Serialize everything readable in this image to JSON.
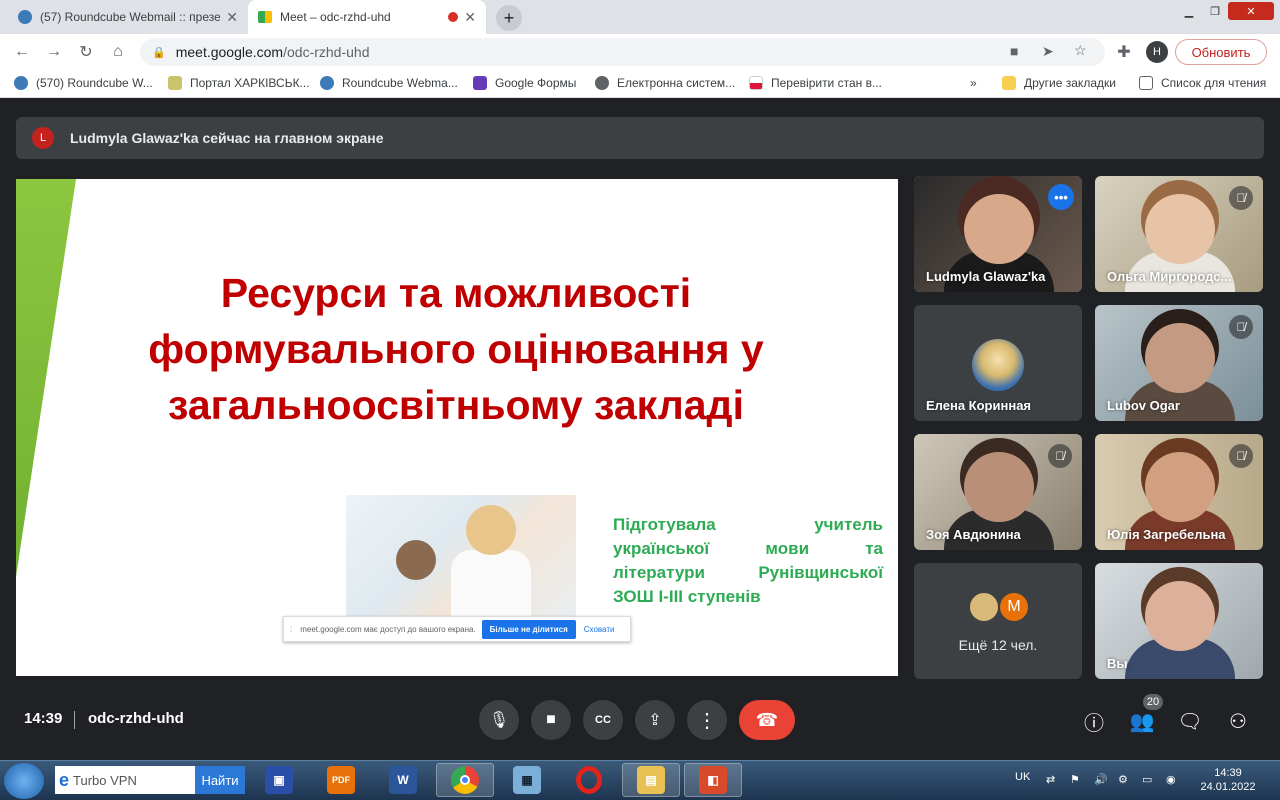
{
  "browser": {
    "tabs": [
      {
        "title": "(57) Roundcube Webmail :: презе",
        "active": false
      },
      {
        "title": "Meet – odc-rzhd-uhd",
        "active": true,
        "recording": true
      }
    ],
    "address": {
      "domain": "meet.google.com",
      "path": "/odc-rzhd-uhd"
    },
    "profile_initial": "H",
    "update_label": "Обновить",
    "bookmarks": [
      {
        "label": "(570) Roundcube W...",
        "icon": "roundcube-icon"
      },
      {
        "label": "Портал ХАРКІВСЬК...",
        "icon": "portal-icon"
      },
      {
        "label": "Roundcube Webma...",
        "icon": "roundcube-icon"
      },
      {
        "label": "Google Формы",
        "icon": "forms-icon"
      },
      {
        "label": "Електронна систем...",
        "icon": "globe-icon"
      },
      {
        "label": "Перевірити стан в...",
        "icon": "flag-icon"
      }
    ],
    "more_bookmarks": "»",
    "other_bookmarks": "Другие закладки",
    "reading_list": "Список для чтения"
  },
  "meet": {
    "banner": {
      "avatar": "L",
      "text": "Ludmyla Glawaz'ka сейчас на главном экране"
    },
    "slide": {
      "title_lines": [
        "Ресурси та можливості",
        "формувального оцінювання  у",
        "загальноосвітньому закладі"
      ],
      "author_lines": [
        "Підготувала        учитель",
        "української      мови      та",
        "літератури   Рунівщинської",
        "ЗОШ І-ІІІ ступенів"
      ]
    },
    "share_bar": {
      "text": "meet.google.com має доступ до вашого екрана.",
      "stop_label": "Більше не ділитися",
      "hide_label": "Сховати"
    },
    "tiles": [
      {
        "name": "Ludmyla Glawaz'ka",
        "muted": false,
        "speaking": true
      },
      {
        "name": "Ольга Миргородс...",
        "muted": true
      },
      {
        "name": "Елена Коринная",
        "muted": false
      },
      {
        "name": "Lubov Ogar",
        "muted": true
      },
      {
        "name": "Зоя Авдюнина",
        "muted": true
      },
      {
        "name": "Юлія Загребельна",
        "muted": true
      },
      {
        "name": "Вы",
        "muted": false
      }
    ],
    "more_participants": {
      "avatar_letter": "M",
      "label": "Ещё 12 чел."
    },
    "bottom": {
      "time": "14:39",
      "meeting_code": "odc-rzhd-uhd",
      "people_count": "20"
    }
  },
  "taskbar": {
    "search_value": "Turbo VPN",
    "search_button": "Найти",
    "apps": [
      "save-app",
      "pdf-app",
      "word-app",
      "chrome-app",
      "calculator-app",
      "opera-app",
      "explorer-app",
      "presentation-app"
    ],
    "language": "UK",
    "time": "14:39",
    "date": "24.01.2022"
  }
}
